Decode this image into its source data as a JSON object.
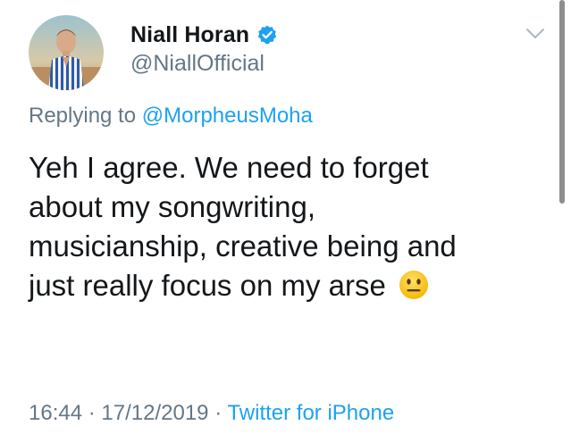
{
  "user": {
    "display_name": "Niall Horan",
    "handle": "@NiallOfficial",
    "verified_icon": "verified-badge-icon",
    "avatar_icon": "avatar-photo"
  },
  "menu": {
    "icon": "chevron-down-icon"
  },
  "reply": {
    "prefix": "Replying to ",
    "mention": "@MorpheusMoha"
  },
  "tweet": {
    "lines": [
      "Yeh I agree. We need to forget",
      "about my songwriting,",
      "musicianship, creative being and",
      "just really focus on my arse"
    ],
    "emoji": "neutral-face-emoji-icon"
  },
  "meta": {
    "time": "16:44",
    "separator": "·",
    "date": "17/12/2019",
    "source": "Twitter for iPhone"
  },
  "colors": {
    "accent": "#1da1f2",
    "secondary_text": "#657786",
    "primary_text": "#14171a"
  }
}
